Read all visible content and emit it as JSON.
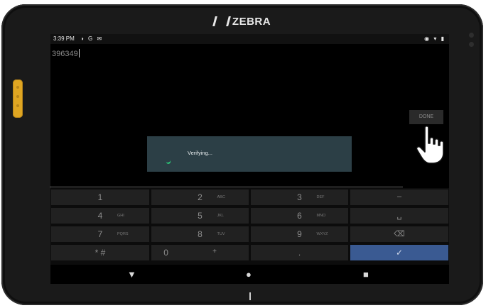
{
  "device": {
    "brand": "ZEBRA"
  },
  "status_bar": {
    "time": "3:39 PM",
    "left_icons": "◑ G ✉",
    "right_icons": "◉ ▾ ▮"
  },
  "input": {
    "value": "396349"
  },
  "done_button": {
    "label": "DONE"
  },
  "dialog": {
    "message": "Verifying..."
  },
  "keypad": {
    "rows": [
      [
        {
          "main": "1",
          "sub": ""
        },
        {
          "main": "2",
          "sub": "ABC"
        },
        {
          "main": "3",
          "sub": "DEF"
        },
        {
          "main": "–",
          "sub": ""
        }
      ],
      [
        {
          "main": "4",
          "sub": "GHI"
        },
        {
          "main": "5",
          "sub": "JKL"
        },
        {
          "main": "6",
          "sub": "MNO"
        },
        {
          "main": "␣",
          "sub": ""
        }
      ],
      [
        {
          "main": "7",
          "sub": "PQRS"
        },
        {
          "main": "8",
          "sub": "TUV"
        },
        {
          "main": "9",
          "sub": "WXYZ"
        },
        {
          "main": "⌫",
          "sub": ""
        }
      ],
      [
        {
          "main": "* #",
          "sub": ""
        },
        {
          "main": "0",
          "sub": "+"
        },
        {
          "main": ".",
          "sub": ""
        },
        {
          "main": "✓",
          "sub": ""
        }
      ]
    ]
  },
  "nav_bar": {
    "back": "▼",
    "home": "●",
    "recents": "■"
  }
}
